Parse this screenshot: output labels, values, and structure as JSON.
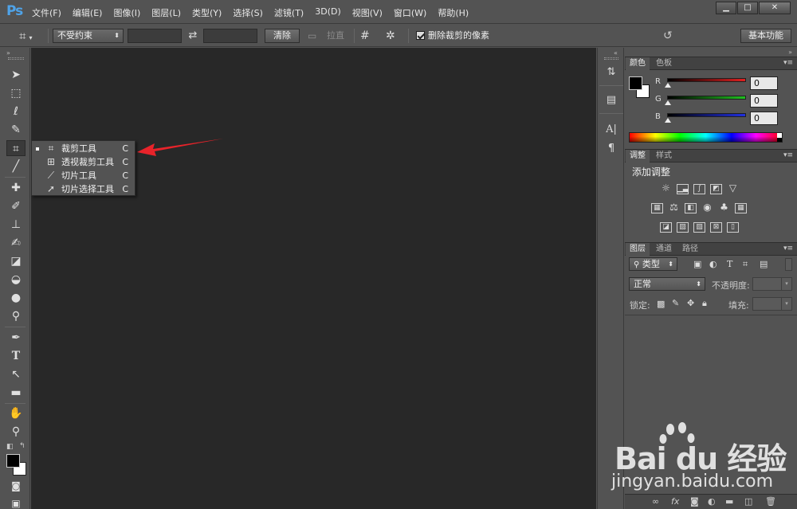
{
  "app": {
    "logo": "Ps"
  },
  "menu": [
    "文件(F)",
    "编辑(E)",
    "图像(I)",
    "图层(L)",
    "类型(Y)",
    "选择(S)",
    "滤镜(T)",
    "3D(D)",
    "视图(V)",
    "窗口(W)",
    "帮助(H)"
  ],
  "window_buttons": {
    "minimize": "▁",
    "maximize": "□",
    "close": "✕"
  },
  "options": {
    "constraint": "不受约束",
    "clear": "清除",
    "straighten": "拉直",
    "delete_cropped": "删除裁剪的像素",
    "workspace": "基本功能"
  },
  "flyout": [
    {
      "label": "裁剪工具",
      "key": "C",
      "selected": true,
      "icon": "crop-icon"
    },
    {
      "label": "透视裁剪工具",
      "key": "C",
      "selected": false,
      "icon": "perspective-crop-icon"
    },
    {
      "label": "切片工具",
      "key": "C",
      "selected": false,
      "icon": "slice-icon"
    },
    {
      "label": "切片选择工具",
      "key": "C",
      "selected": false,
      "icon": "slice-select-icon"
    }
  ],
  "color_panel": {
    "tabs": [
      "颜色",
      "色板"
    ],
    "channels": [
      {
        "label": "R",
        "value": "0",
        "color": "#e02020"
      },
      {
        "label": "G",
        "value": "0",
        "color": "#20c020"
      },
      {
        "label": "B",
        "value": "0",
        "color": "#2030e0"
      }
    ]
  },
  "adjust_panel": {
    "tabs": [
      "调整",
      "样式"
    ],
    "title": "添加调整"
  },
  "layers_panel": {
    "tabs": [
      "图层",
      "通道",
      "路径"
    ],
    "filter": "类型",
    "blend_mode": "正常",
    "opacity_label": "不透明度:",
    "lock_label": "锁定:",
    "fill_label": "填充:"
  },
  "watermark": {
    "brand": "Bai du 经验",
    "url": "jingyan.baidu.com"
  }
}
